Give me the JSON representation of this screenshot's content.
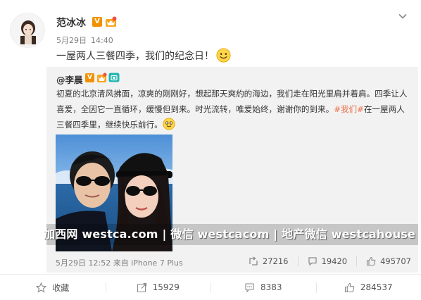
{
  "post": {
    "author": "范冰冰",
    "verified_badge": "V",
    "date": "5月29日",
    "time": "14:40",
    "text": "一屋两人三餐四季，我们的纪念日！",
    "more_icon": "chevron-down-icon",
    "emoji": "smile-emoji"
  },
  "repost": {
    "user": "@李晨",
    "verified_badge": "V",
    "text_part1": "初夏的北京清风拂面，凉爽的刚刚好，想起那天爽約的海边，我们走在阳光里肩并着肩。四季让人喜爱，全因它一直循环，缓慢但到来。时光流转，唯爱始终，谢谢你的到来。",
    "hashtag": "#我们#",
    "text_part2": "在一屋两人三餐四季里，继续快乐前行。",
    "emoji": "happy-emoji",
    "watermark": "加西网 westca.com | 微信 westcacom | 地产微信 westcahouse",
    "date": "5月29日 12:52",
    "source": "来自 iPhone 7 Plus",
    "reposts": "27216",
    "comments": "19420",
    "likes": "495707"
  },
  "actions": {
    "favorite": "收藏",
    "repost": "15929",
    "comment": "8383",
    "like": "284537"
  },
  "colors": {
    "hashtag": "#eb7350",
    "badge": "#f29100",
    "repost_bg": "#f2f2f2",
    "meta": "#808080"
  }
}
